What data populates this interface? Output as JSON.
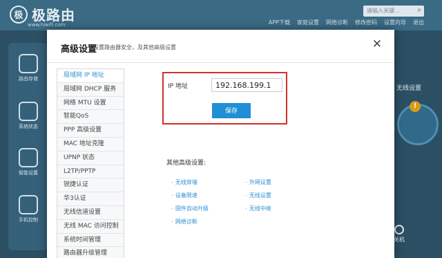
{
  "background": {
    "logo_text": "极路由",
    "logo_mark": "极",
    "logo_sub": "www.hiwifi.com",
    "search_placeholder": "请输入关键...",
    "toplinks": [
      "APP下载",
      "家庭设置",
      "网络诊断",
      "修改密码",
      "设置向导",
      "退出"
    ],
    "nav": [
      {
        "label": "路由存储"
      },
      {
        "label": "系统状态"
      },
      {
        "label": "智能设置"
      },
      {
        "label": "手机控制"
      }
    ],
    "right_label": "无线设置",
    "badge": "!",
    "power_label": "关机"
  },
  "modal": {
    "title": "高级设置",
    "subtitle": "设置路由器安全，及其他高级设置",
    "close_glyph": "✕",
    "menu": [
      {
        "label": "局域网 IP 地址",
        "active": true
      },
      {
        "label": "局域网 DHCP 服务"
      },
      {
        "label": "网络 MTU 设置"
      },
      {
        "label": "智能QoS"
      },
      {
        "label": "PPP 高级设置"
      },
      {
        "label": "MAC 地址克隆"
      },
      {
        "label": "UPNP 状态"
      },
      {
        "label": "L2TP/PPTP"
      },
      {
        "label": "锐捷认证"
      },
      {
        "label": "华3认证"
      },
      {
        "label": "无线信道设置"
      },
      {
        "label": "无线 MAC 访问控制"
      },
      {
        "label": "系统时间管理"
      },
      {
        "label": "路由器升级管理"
      }
    ],
    "ip_label": "IP 地址",
    "ip_value": "192.168.199.1",
    "save_label": "保存",
    "other_title": "其他高级设置:",
    "other_links": [
      "无线穿墙",
      "外网设置",
      "设备限速",
      "无线设置",
      "固件自动升级",
      "无线中继",
      "网络诊断"
    ]
  },
  "colors": {
    "accent": "#1f8fd6",
    "highlight_border": "#d0302b",
    "link": "#2f8fd0"
  }
}
